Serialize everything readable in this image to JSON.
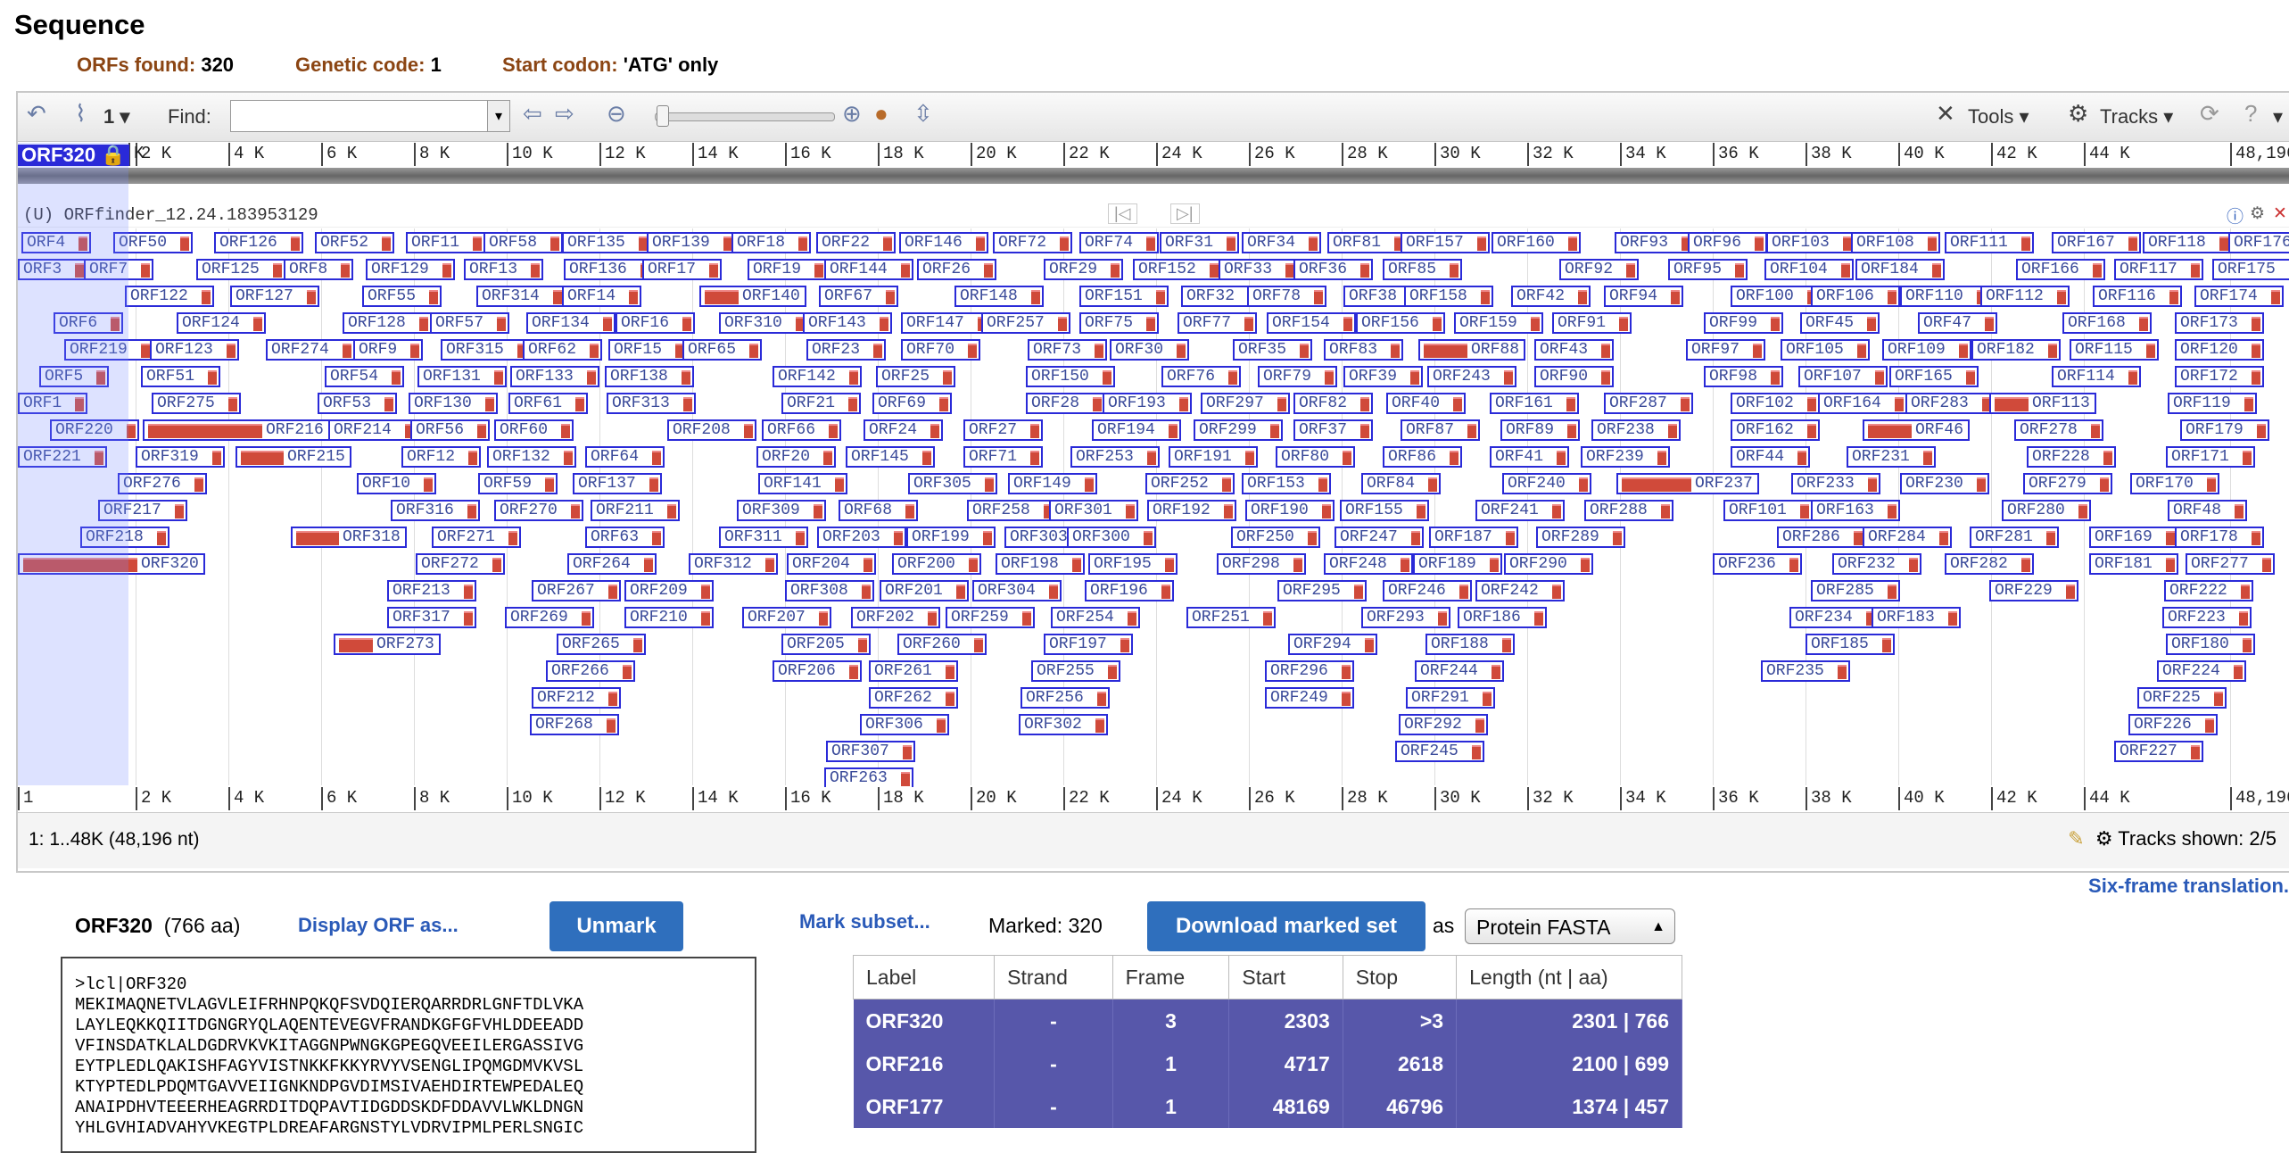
{
  "page": {
    "title": "Sequence"
  },
  "summary": {
    "orfs_label": "ORFs found:",
    "orfs_value": "320",
    "code_label": "Genetic code:",
    "code_value": "1",
    "start_label": "Start codon:",
    "start_value": "'ATG' only"
  },
  "toolbar": {
    "count": "1",
    "find_label": "Find:",
    "tools_label": "Tools",
    "tracks_label": "Tracks"
  },
  "ruler": {
    "first": "1",
    "labels": [
      "2 K",
      "4 K",
      "6 K",
      "8 K",
      "10 K",
      "12 K",
      "14 K",
      "16 K",
      "18 K",
      "20 K",
      "22 K",
      "24 K",
      "26 K",
      "28 K",
      "30 K",
      "32 K",
      "34 K",
      "36 K",
      "38 K",
      "40 K",
      "42 K",
      "44 K",
      "48,196"
    ],
    "top_first": "K"
  },
  "selection": {
    "tag": "ORF320"
  },
  "track": {
    "label": "(U) ORFfinder_12.24.183953129"
  },
  "orfs": [
    [
      "ORF4",
      4,
      0
    ],
    [
      "ORF50",
      107,
      0
    ],
    [
      "ORF126",
      220,
      0
    ],
    [
      "ORF52",
      333,
      0
    ],
    [
      "ORF11",
      435,
      0
    ],
    [
      "ORF58",
      522,
      0
    ],
    [
      "ORF135",
      610,
      0
    ],
    [
      "ORF139",
      705,
      0
    ],
    [
      "ORF18",
      800,
      0
    ],
    [
      "ORF22",
      895,
      0
    ],
    [
      "ORF146",
      988,
      0
    ],
    [
      "ORF72",
      1093,
      0
    ],
    [
      "ORF74",
      1190,
      0
    ],
    [
      "ORF31",
      1280,
      0
    ],
    [
      "ORF34",
      1372,
      0
    ],
    [
      "ORF81",
      1468,
      0
    ],
    [
      "ORF157",
      1550,
      0
    ],
    [
      "ORF160",
      1652,
      0
    ],
    [
      "ORF93",
      1790,
      0
    ],
    [
      "ORF96",
      1872,
      0
    ],
    [
      "ORF103",
      1960,
      0
    ],
    [
      "ORF108",
      2055,
      0
    ],
    [
      "ORF111",
      2160,
      0
    ],
    [
      "ORF167",
      2280,
      0
    ],
    [
      "ORF118",
      2382,
      0
    ],
    [
      "ORF176",
      2478,
      0
    ],
    [
      "ORF3",
      0,
      1
    ],
    [
      "ORF7",
      74,
      1
    ],
    [
      "ORF125",
      200,
      1
    ],
    [
      "ORF8",
      298,
      1
    ],
    [
      "ORF129",
      390,
      1
    ],
    [
      "ORF13",
      500,
      1
    ],
    [
      "ORF136",
      612,
      1
    ],
    [
      "ORF17",
      700,
      1
    ],
    [
      "ORF19",
      818,
      1
    ],
    [
      "ORF144",
      904,
      1
    ],
    [
      "ORF26",
      1008,
      1
    ],
    [
      "ORF29",
      1150,
      1
    ],
    [
      "ORF152",
      1250,
      1
    ],
    [
      "ORF33",
      1346,
      1
    ],
    [
      "ORF36",
      1430,
      1
    ],
    [
      "ORF85",
      1530,
      1
    ],
    [
      "ORF92",
      1728,
      1
    ],
    [
      "ORF95",
      1850,
      1
    ],
    [
      "ORF104",
      1958,
      1
    ],
    [
      "ORF184",
      2060,
      1
    ],
    [
      "ORF166",
      2240,
      1
    ],
    [
      "ORF117",
      2350,
      1
    ],
    [
      "ORF175",
      2460,
      1
    ],
    [
      "ORF122",
      120,
      2
    ],
    [
      "ORF127",
      238,
      2
    ],
    [
      "ORF55",
      386,
      2
    ],
    [
      "ORF314",
      514,
      2
    ],
    [
      "ORF14",
      610,
      2
    ],
    [
      "ORF140",
      764,
      2
    ],
    [
      "ORF67",
      898,
      2
    ],
    [
      "ORF148",
      1050,
      2
    ],
    [
      "ORF151",
      1190,
      2
    ],
    [
      "ORF32",
      1304,
      2
    ],
    [
      "ORF78",
      1378,
      2
    ],
    [
      "ORF38",
      1486,
      2
    ],
    [
      "ORF158",
      1554,
      2
    ],
    [
      "ORF42",
      1674,
      2
    ],
    [
      "ORF94",
      1778,
      2
    ],
    [
      "ORF100",
      1920,
      2
    ],
    [
      "ORF106",
      2010,
      2
    ],
    [
      "ORF110",
      2110,
      2
    ],
    [
      "ORF112",
      2200,
      2
    ],
    [
      "ORF116",
      2326,
      2
    ],
    [
      "ORF174",
      2440,
      2
    ],
    [
      "ORF6",
      40,
      3
    ],
    [
      "ORF124",
      178,
      3
    ],
    [
      "ORF128",
      364,
      3
    ],
    [
      "ORF57",
      462,
      3
    ],
    [
      "ORF134",
      570,
      3
    ],
    [
      "ORF16",
      670,
      3
    ],
    [
      "ORF310",
      786,
      3
    ],
    [
      "ORF143",
      880,
      3
    ],
    [
      "ORF147",
      990,
      3
    ],
    [
      "ORF257",
      1080,
      3
    ],
    [
      "ORF75",
      1190,
      3
    ],
    [
      "ORF77",
      1300,
      3
    ],
    [
      "ORF154",
      1400,
      3
    ],
    [
      "ORF156",
      1500,
      3
    ],
    [
      "ORF159",
      1610,
      3
    ],
    [
      "ORF91",
      1720,
      3
    ],
    [
      "ORF99",
      1890,
      3
    ],
    [
      "ORF45",
      1998,
      3
    ],
    [
      "ORF47",
      2130,
      3
    ],
    [
      "ORF168",
      2292,
      3
    ],
    [
      "ORF173",
      2418,
      3
    ],
    [
      "ORF219",
      52,
      4
    ],
    [
      "ORF123",
      148,
      4
    ],
    [
      "ORF274",
      278,
      4
    ],
    [
      "ORF9",
      376,
      4
    ],
    [
      "ORF315",
      474,
      4
    ],
    [
      "ORF62",
      566,
      4
    ],
    [
      "ORF15",
      662,
      4
    ],
    [
      "ORF65",
      745,
      4
    ],
    [
      "ORF23",
      884,
      4
    ],
    [
      "ORF70",
      990,
      4
    ],
    [
      "ORF73",
      1132,
      4
    ],
    [
      "ORF30",
      1224,
      4
    ],
    [
      "ORF35",
      1362,
      4
    ],
    [
      "ORF83",
      1464,
      4
    ],
    [
      "ORF88",
      1570,
      4
    ],
    [
      "ORF43",
      1700,
      4
    ],
    [
      "ORF97",
      1870,
      4
    ],
    [
      "ORF105",
      1976,
      4
    ],
    [
      "ORF109",
      2090,
      4
    ],
    [
      "ORF182",
      2190,
      4
    ],
    [
      "ORF115",
      2300,
      4
    ],
    [
      "ORF120",
      2418,
      4
    ],
    [
      "ORF5",
      24,
      5
    ],
    [
      "ORF51",
      138,
      5
    ],
    [
      "ORF54",
      344,
      5
    ],
    [
      "ORF131",
      448,
      5
    ],
    [
      "ORF133",
      552,
      5
    ],
    [
      "ORF138",
      658,
      5
    ],
    [
      "ORF142",
      846,
      5
    ],
    [
      "ORF25",
      962,
      5
    ],
    [
      "ORF150",
      1130,
      5
    ],
    [
      "ORF76",
      1282,
      5
    ],
    [
      "ORF79",
      1390,
      5
    ],
    [
      "ORF39",
      1486,
      5
    ],
    [
      "ORF243",
      1580,
      5
    ],
    [
      "ORF90",
      1700,
      5
    ],
    [
      "ORF98",
      1890,
      5
    ],
    [
      "ORF107",
      1996,
      5
    ],
    [
      "ORF165",
      2098,
      5
    ],
    [
      "ORF114",
      2280,
      5
    ],
    [
      "ORF172",
      2418,
      5
    ],
    [
      "ORF1",
      0,
      6
    ],
    [
      "ORF275",
      150,
      6
    ],
    [
      "ORF53",
      336,
      6
    ],
    [
      "ORF130",
      438,
      6
    ],
    [
      "ORF61",
      550,
      6
    ],
    [
      "ORF313",
      660,
      6
    ],
    [
      "ORF21",
      856,
      6
    ],
    [
      "ORF69",
      958,
      6
    ],
    [
      "ORF28",
      1130,
      6
    ],
    [
      "ORF193",
      1216,
      6
    ],
    [
      "ORF297",
      1326,
      6
    ],
    [
      "ORF82",
      1430,
      6
    ],
    [
      "ORF40",
      1534,
      6
    ],
    [
      "ORF161",
      1650,
      6
    ],
    [
      "ORF287",
      1778,
      6
    ],
    [
      "ORF102",
      1920,
      6
    ],
    [
      "ORF164",
      2018,
      6
    ],
    [
      "ORF283",
      2116,
      6
    ],
    [
      "ORF113",
      2210,
      6
    ],
    [
      "ORF119",
      2410,
      6
    ],
    [
      "ORF220",
      36,
      7
    ],
    [
      "ORF216",
      140,
      7
    ],
    [
      "ORF214",
      348,
      7
    ],
    [
      "ORF56",
      440,
      7
    ],
    [
      "ORF60",
      534,
      7
    ],
    [
      "ORF208",
      728,
      7
    ],
    [
      "ORF66",
      834,
      7
    ],
    [
      "ORF24",
      948,
      7
    ],
    [
      "ORF27",
      1060,
      7
    ],
    [
      "ORF194",
      1204,
      7
    ],
    [
      "ORF299",
      1318,
      7
    ],
    [
      "ORF37",
      1430,
      7
    ],
    [
      "ORF87",
      1550,
      7
    ],
    [
      "ORF89",
      1662,
      7
    ],
    [
      "ORF238",
      1764,
      7
    ],
    [
      "ORF162",
      1920,
      7
    ],
    [
      "ORF46",
      2068,
      7
    ],
    [
      "ORF278",
      2238,
      7
    ],
    [
      "ORF179",
      2424,
      7
    ],
    [
      "ORF221",
      0,
      8
    ],
    [
      "ORF319",
      132,
      8
    ],
    [
      "ORF215",
      244,
      8
    ],
    [
      "ORF12",
      430,
      8
    ],
    [
      "ORF132",
      526,
      8
    ],
    [
      "ORF64",
      636,
      8
    ],
    [
      "ORF20",
      828,
      8
    ],
    [
      "ORF145",
      928,
      8
    ],
    [
      "ORF71",
      1060,
      8
    ],
    [
      "ORF253",
      1180,
      8
    ],
    [
      "ORF191",
      1290,
      8
    ],
    [
      "ORF80",
      1410,
      8
    ],
    [
      "ORF86",
      1530,
      8
    ],
    [
      "ORF41",
      1650,
      8
    ],
    [
      "ORF239",
      1752,
      8
    ],
    [
      "ORF44",
      1920,
      8
    ],
    [
      "ORF231",
      2050,
      8
    ],
    [
      "ORF228",
      2252,
      8
    ],
    [
      "ORF171",
      2408,
      8
    ],
    [
      "ORF276",
      112,
      9
    ],
    [
      "ORF10",
      380,
      9
    ],
    [
      "ORF59",
      516,
      9
    ],
    [
      "ORF137",
      622,
      9
    ],
    [
      "ORF141",
      830,
      9
    ],
    [
      "ORF305",
      998,
      9
    ],
    [
      "ORF149",
      1110,
      9
    ],
    [
      "ORF252",
      1264,
      9
    ],
    [
      "ORF153",
      1372,
      9
    ],
    [
      "ORF84",
      1506,
      9
    ],
    [
      "ORF240",
      1664,
      9
    ],
    [
      "ORF237",
      1792,
      9
    ],
    [
      "ORF233",
      1988,
      9
    ],
    [
      "ORF230",
      2110,
      9
    ],
    [
      "ORF279",
      2248,
      9
    ],
    [
      "ORF170",
      2368,
      9
    ],
    [
      "ORF217",
      90,
      10
    ],
    [
      "ORF316",
      418,
      10
    ],
    [
      "ORF270",
      534,
      10
    ],
    [
      "ORF211",
      642,
      10
    ],
    [
      "ORF309",
      806,
      10
    ],
    [
      "ORF68",
      920,
      10
    ],
    [
      "ORF258",
      1064,
      10
    ],
    [
      "ORF301",
      1156,
      10
    ],
    [
      "ORF192",
      1266,
      10
    ],
    [
      "ORF190",
      1376,
      10
    ],
    [
      "ORF155",
      1482,
      10
    ],
    [
      "ORF241",
      1634,
      10
    ],
    [
      "ORF288",
      1756,
      10
    ],
    [
      "ORF101",
      1912,
      10
    ],
    [
      "ORF163",
      2010,
      10
    ],
    [
      "ORF280",
      2224,
      10
    ],
    [
      "ORF48",
      2410,
      10
    ],
    [
      "ORF218",
      70,
      11
    ],
    [
      "ORF318",
      306,
      11
    ],
    [
      "ORF271",
      464,
      11
    ],
    [
      "ORF63",
      636,
      11
    ],
    [
      "ORF311",
      786,
      11
    ],
    [
      "ORF203",
      896,
      11
    ],
    [
      "ORF199",
      996,
      11
    ],
    [
      "ORF303",
      1106,
      11
    ],
    [
      "ORF300",
      1176,
      11
    ],
    [
      "ORF250",
      1360,
      11
    ],
    [
      "ORF247",
      1476,
      11
    ],
    [
      "ORF187",
      1582,
      11
    ],
    [
      "ORF289",
      1702,
      11
    ],
    [
      "ORF286",
      1972,
      11
    ],
    [
      "ORF284",
      2068,
      11
    ],
    [
      "ORF281",
      2188,
      11
    ],
    [
      "ORF169",
      2322,
      11
    ],
    [
      "ORF178",
      2418,
      11
    ],
    [
      "ORF320",
      0,
      12
    ],
    [
      "ORF272",
      446,
      12
    ],
    [
      "ORF264",
      616,
      12
    ],
    [
      "ORF312",
      752,
      12
    ],
    [
      "ORF204",
      862,
      12
    ],
    [
      "ORF200",
      980,
      12
    ],
    [
      "ORF198",
      1096,
      12
    ],
    [
      "ORF195",
      1200,
      12
    ],
    [
      "ORF298",
      1344,
      12
    ],
    [
      "ORF248",
      1464,
      12
    ],
    [
      "ORF189",
      1564,
      12
    ],
    [
      "ORF290",
      1666,
      12
    ],
    [
      "ORF236",
      1900,
      12
    ],
    [
      "ORF232",
      2034,
      12
    ],
    [
      "ORF282",
      2160,
      12
    ],
    [
      "ORF181",
      2322,
      12
    ],
    [
      "ORF277",
      2430,
      12
    ],
    [
      "ORF213",
      414,
      13
    ],
    [
      "ORF267",
      576,
      13
    ],
    [
      "ORF209",
      680,
      13
    ],
    [
      "ORF308",
      860,
      13
    ],
    [
      "ORF201",
      966,
      13
    ],
    [
      "ORF304",
      1070,
      13
    ],
    [
      "ORF196",
      1196,
      13
    ],
    [
      "ORF295",
      1412,
      13
    ],
    [
      "ORF246",
      1530,
      13
    ],
    [
      "ORF242",
      1634,
      13
    ],
    [
      "ORF285",
      2010,
      13
    ],
    [
      "ORF229",
      2210,
      13
    ],
    [
      "ORF222",
      2406,
      13
    ],
    [
      "ORF317",
      414,
      14
    ],
    [
      "ORF269",
      546,
      14
    ],
    [
      "ORF210",
      680,
      14
    ],
    [
      "ORF207",
      812,
      14
    ],
    [
      "ORF202",
      934,
      14
    ],
    [
      "ORF259",
      1040,
      14
    ],
    [
      "ORF254",
      1158,
      14
    ],
    [
      "ORF251",
      1310,
      14
    ],
    [
      "ORF293",
      1506,
      14
    ],
    [
      "ORF186",
      1614,
      14
    ],
    [
      "ORF234",
      1986,
      14
    ],
    [
      "ORF183",
      2078,
      14
    ],
    [
      "ORF223",
      2404,
      14
    ],
    [
      "ORF273",
      354,
      15
    ],
    [
      "ORF265",
      604,
      15
    ],
    [
      "ORF205",
      856,
      15
    ],
    [
      "ORF260",
      986,
      15
    ],
    [
      "ORF197",
      1150,
      15
    ],
    [
      "ORF294",
      1424,
      15
    ],
    [
      "ORF188",
      1578,
      15
    ],
    [
      "ORF185",
      2004,
      15
    ],
    [
      "ORF180",
      2408,
      15
    ],
    [
      "ORF266",
      592,
      16
    ],
    [
      "ORF206",
      846,
      16
    ],
    [
      "ORF261",
      954,
      16
    ],
    [
      "ORF255",
      1136,
      16
    ],
    [
      "ORF296",
      1398,
      16
    ],
    [
      "ORF244",
      1566,
      16
    ],
    [
      "ORF235",
      1954,
      16
    ],
    [
      "ORF224",
      2398,
      16
    ],
    [
      "ORF212",
      576,
      17
    ],
    [
      "ORF262",
      954,
      17
    ],
    [
      "ORF256",
      1124,
      17
    ],
    [
      "ORF249",
      1398,
      17
    ],
    [
      "ORF291",
      1556,
      17
    ],
    [
      "ORF225",
      2376,
      17
    ],
    [
      "ORF268",
      574,
      18
    ],
    [
      "ORF306",
      944,
      18
    ],
    [
      "ORF302",
      1122,
      18
    ],
    [
      "ORF292",
      1548,
      18
    ],
    [
      "ORF226",
      2366,
      18
    ],
    [
      "ORF307",
      906,
      19
    ],
    [
      "ORF245",
      1544,
      19
    ],
    [
      "ORF227",
      2350,
      19
    ],
    [
      "ORF263",
      904,
      20
    ]
  ],
  "status": {
    "range": "1: 1..48K (48,196 nt)",
    "tracks_shown": "Tracks shown: 2/5"
  },
  "six_frame": "Six-frame translation.",
  "detail": {
    "orf_name": "ORF320",
    "orf_len": "(766 aa)",
    "display_as": "Display ORF as...",
    "unmark": "Unmark",
    "mark_subset": "Mark subset...",
    "marked": "Marked: 320",
    "download": "Download marked set",
    "as": "as",
    "format": "Protein FASTA"
  },
  "sequence": ">lcl|ORF320\nMEKIMAQNETVLAGVLEIFRHNPQKQFSVDQIERQARRDRLGNFTDLVKA\nLAYLEQKKQIITDGNGRYQLAQENTEVEGVFRANDKGFGFVHLDDEEADD\nVFINSDATKLALDGDRVKVKITAGGNPWNGKGPEGQVEEILERGASSIVG\nEYTPLEDLQAKISHFAGYVISTNKKFKKYRVYVSENGLIPQMGDMVKVSL\nKTYPTEDLPDQMTGAVVEIIGNKNDPGVDIMSIVAEHDIRTEWPEDALEQ\nANAIPDHVTEEERHEAGRRDITDQPAVTIDGDDSKDFDDAVVLWKLDNGN\nYHLGVHIADVAHYVKEGTPLDREAFARGNSTYLVDRVIPMLPERLSNGIC",
  "table": {
    "headers": [
      "Label",
      "Strand",
      "Frame",
      "Start",
      "Stop",
      "Length (nt | aa)"
    ],
    "rows": [
      [
        "ORF320",
        "-",
        "3",
        "2303",
        ">3",
        "2301 | 766"
      ],
      [
        "ORF216",
        "-",
        "1",
        "4717",
        "2618",
        "2100 | 699"
      ],
      [
        "ORF177",
        "-",
        "1",
        "48169",
        "46796",
        "1374 | 457"
      ]
    ]
  }
}
